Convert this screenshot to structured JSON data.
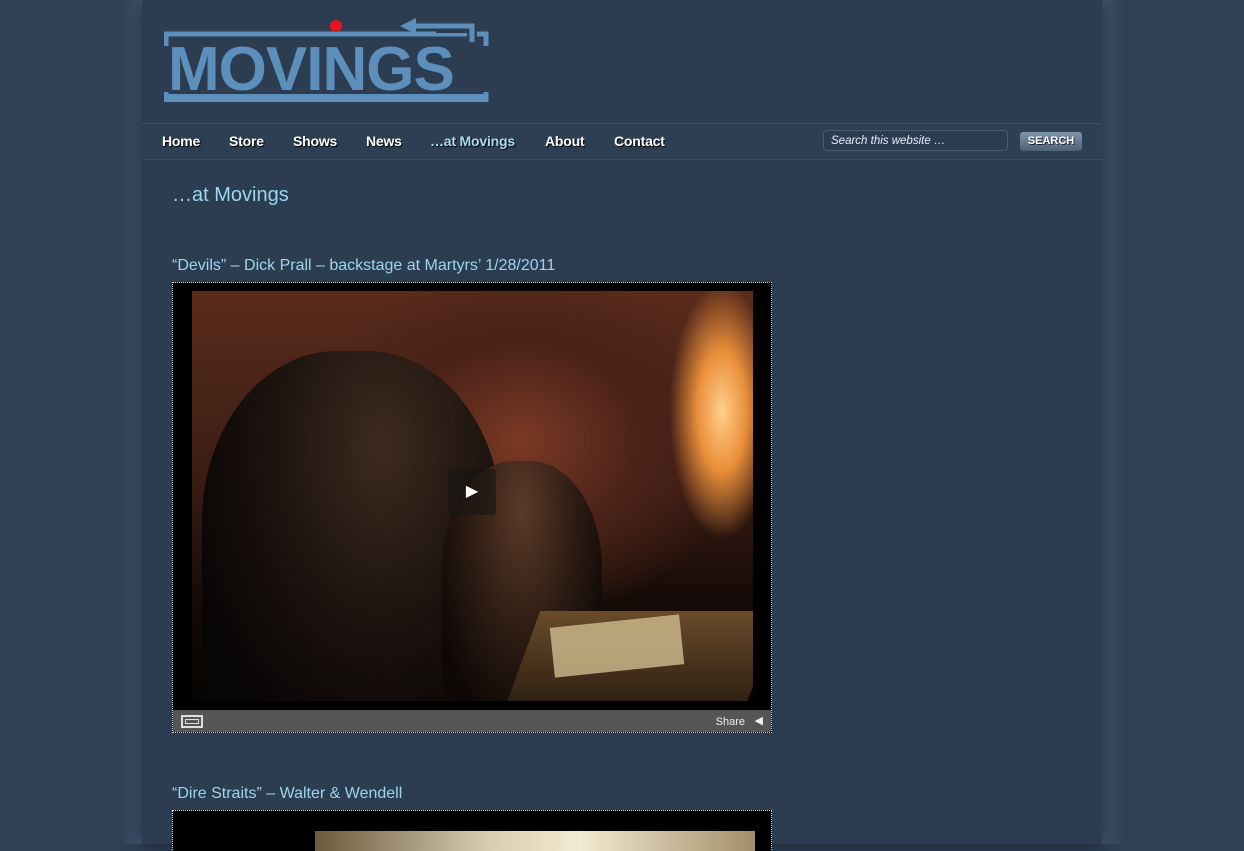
{
  "site": {
    "logo_text": "MOVINGS",
    "logo_colors": {
      "text": "#5d8fbd",
      "dot": "#e3141c",
      "frame": "#5d8fbd"
    }
  },
  "nav": {
    "items": [
      {
        "label": "Home"
      },
      {
        "label": "Store"
      },
      {
        "label": "Shows"
      },
      {
        "label": "News"
      },
      {
        "label": "…at Movings"
      },
      {
        "label": "About"
      },
      {
        "label": "Contact"
      }
    ],
    "active": "…at Movings"
  },
  "search": {
    "placeholder": "Search this website …",
    "button_label": "SEARCH"
  },
  "main": {
    "page_title": "…at Movings",
    "posts": [
      {
        "title": "“Devils” – Dick Prall – backstage at Martyrs’ 1/28/2011",
        "video": {
          "share_label": "Share"
        }
      },
      {
        "title": "“Dire Straits” – Walter & Wendell"
      }
    ]
  },
  "colors": {
    "background": "#2f4055",
    "accent_text": "#9ad6ee"
  }
}
